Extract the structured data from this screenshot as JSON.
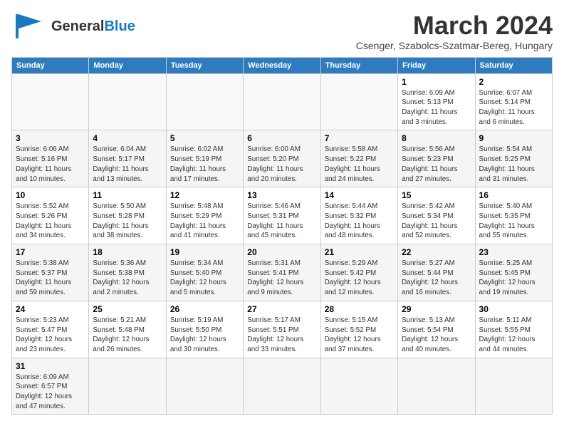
{
  "header": {
    "logo_text_general": "General",
    "logo_text_blue": "Blue",
    "month_title": "March 2024",
    "location": "Csenger, Szabolcs-Szatmar-Bereg, Hungary"
  },
  "days_of_week": [
    "Sunday",
    "Monday",
    "Tuesday",
    "Wednesday",
    "Thursday",
    "Friday",
    "Saturday"
  ],
  "weeks": [
    [
      {
        "day": "",
        "info": ""
      },
      {
        "day": "",
        "info": ""
      },
      {
        "day": "",
        "info": ""
      },
      {
        "day": "",
        "info": ""
      },
      {
        "day": "",
        "info": ""
      },
      {
        "day": "1",
        "info": "Sunrise: 6:09 AM\nSunset: 5:13 PM\nDaylight: 11 hours\nand 3 minutes."
      },
      {
        "day": "2",
        "info": "Sunrise: 6:07 AM\nSunset: 5:14 PM\nDaylight: 11 hours\nand 6 minutes."
      }
    ],
    [
      {
        "day": "3",
        "info": "Sunrise: 6:06 AM\nSunset: 5:16 PM\nDaylight: 11 hours\nand 10 minutes."
      },
      {
        "day": "4",
        "info": "Sunrise: 6:04 AM\nSunset: 5:17 PM\nDaylight: 11 hours\nand 13 minutes."
      },
      {
        "day": "5",
        "info": "Sunrise: 6:02 AM\nSunset: 5:19 PM\nDaylight: 11 hours\nand 17 minutes."
      },
      {
        "day": "6",
        "info": "Sunrise: 6:00 AM\nSunset: 5:20 PM\nDaylight: 11 hours\nand 20 minutes."
      },
      {
        "day": "7",
        "info": "Sunrise: 5:58 AM\nSunset: 5:22 PM\nDaylight: 11 hours\nand 24 minutes."
      },
      {
        "day": "8",
        "info": "Sunrise: 5:56 AM\nSunset: 5:23 PM\nDaylight: 11 hours\nand 27 minutes."
      },
      {
        "day": "9",
        "info": "Sunrise: 5:54 AM\nSunset: 5:25 PM\nDaylight: 11 hours\nand 31 minutes."
      }
    ],
    [
      {
        "day": "10",
        "info": "Sunrise: 5:52 AM\nSunset: 5:26 PM\nDaylight: 11 hours\nand 34 minutes."
      },
      {
        "day": "11",
        "info": "Sunrise: 5:50 AM\nSunset: 5:28 PM\nDaylight: 11 hours\nand 38 minutes."
      },
      {
        "day": "12",
        "info": "Sunrise: 5:48 AM\nSunset: 5:29 PM\nDaylight: 11 hours\nand 41 minutes."
      },
      {
        "day": "13",
        "info": "Sunrise: 5:46 AM\nSunset: 5:31 PM\nDaylight: 11 hours\nand 45 minutes."
      },
      {
        "day": "14",
        "info": "Sunrise: 5:44 AM\nSunset: 5:32 PM\nDaylight: 11 hours\nand 48 minutes."
      },
      {
        "day": "15",
        "info": "Sunrise: 5:42 AM\nSunset: 5:34 PM\nDaylight: 11 hours\nand 52 minutes."
      },
      {
        "day": "16",
        "info": "Sunrise: 5:40 AM\nSunset: 5:35 PM\nDaylight: 11 hours\nand 55 minutes."
      }
    ],
    [
      {
        "day": "17",
        "info": "Sunrise: 5:38 AM\nSunset: 5:37 PM\nDaylight: 11 hours\nand 59 minutes."
      },
      {
        "day": "18",
        "info": "Sunrise: 5:36 AM\nSunset: 5:38 PM\nDaylight: 12 hours\nand 2 minutes."
      },
      {
        "day": "19",
        "info": "Sunrise: 5:34 AM\nSunset: 5:40 PM\nDaylight: 12 hours\nand 5 minutes."
      },
      {
        "day": "20",
        "info": "Sunrise: 5:31 AM\nSunset: 5:41 PM\nDaylight: 12 hours\nand 9 minutes."
      },
      {
        "day": "21",
        "info": "Sunrise: 5:29 AM\nSunset: 5:42 PM\nDaylight: 12 hours\nand 12 minutes."
      },
      {
        "day": "22",
        "info": "Sunrise: 5:27 AM\nSunset: 5:44 PM\nDaylight: 12 hours\nand 16 minutes."
      },
      {
        "day": "23",
        "info": "Sunrise: 5:25 AM\nSunset: 5:45 PM\nDaylight: 12 hours\nand 19 minutes."
      }
    ],
    [
      {
        "day": "24",
        "info": "Sunrise: 5:23 AM\nSunset: 5:47 PM\nDaylight: 12 hours\nand 23 minutes."
      },
      {
        "day": "25",
        "info": "Sunrise: 5:21 AM\nSunset: 5:48 PM\nDaylight: 12 hours\nand 26 minutes."
      },
      {
        "day": "26",
        "info": "Sunrise: 5:19 AM\nSunset: 5:50 PM\nDaylight: 12 hours\nand 30 minutes."
      },
      {
        "day": "27",
        "info": "Sunrise: 5:17 AM\nSunset: 5:51 PM\nDaylight: 12 hours\nand 33 minutes."
      },
      {
        "day": "28",
        "info": "Sunrise: 5:15 AM\nSunset: 5:52 PM\nDaylight: 12 hours\nand 37 minutes."
      },
      {
        "day": "29",
        "info": "Sunrise: 5:13 AM\nSunset: 5:54 PM\nDaylight: 12 hours\nand 40 minutes."
      },
      {
        "day": "30",
        "info": "Sunrise: 5:11 AM\nSunset: 5:55 PM\nDaylight: 12 hours\nand 44 minutes."
      }
    ],
    [
      {
        "day": "31",
        "info": "Sunrise: 6:09 AM\nSunset: 6:57 PM\nDaylight: 12 hours\nand 47 minutes."
      },
      {
        "day": "",
        "info": ""
      },
      {
        "day": "",
        "info": ""
      },
      {
        "day": "",
        "info": ""
      },
      {
        "day": "",
        "info": ""
      },
      {
        "day": "",
        "info": ""
      },
      {
        "day": "",
        "info": ""
      }
    ]
  ]
}
